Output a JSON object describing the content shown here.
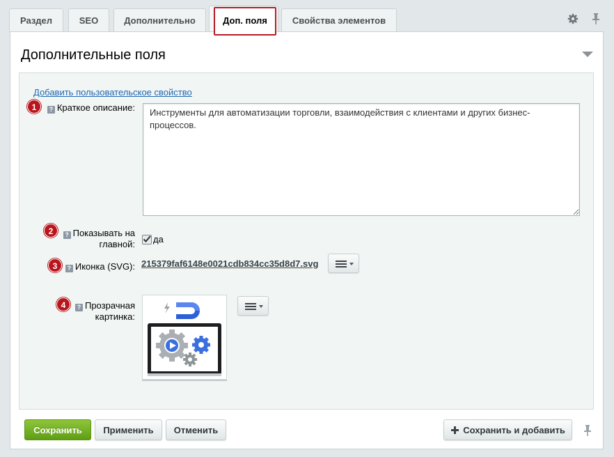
{
  "tabs": [
    {
      "label": "Раздел",
      "active": false
    },
    {
      "label": "SEO",
      "active": false
    },
    {
      "label": "Дополнительно",
      "active": false
    },
    {
      "label": "Доп. поля",
      "active": true
    },
    {
      "label": "Свойства элементов",
      "active": false
    }
  ],
  "section": {
    "title": "Дополнительные поля",
    "add_property_link": "Добавить пользовательское свойство"
  },
  "fields": [
    {
      "badge": "1",
      "label": "Краткое описание:",
      "value": "Инструменты для автоматизации торговли, взаимодействия с клиентами и других бизнес-процессов."
    },
    {
      "badge": "2",
      "label_line1": "Показывать на",
      "label_line2": "главной:",
      "checked": true,
      "checkbox_label": "да"
    },
    {
      "badge": "3",
      "label": "Иконка (SVG):",
      "file_name": "215379faf6148e0021cdb834cc35d8d7.svg"
    },
    {
      "badge": "4",
      "label_line1": "Прозрачная",
      "label_line2": "картинка:"
    }
  ],
  "help_glyph": "?",
  "buttons": {
    "save": "Сохранить",
    "apply": "Применить",
    "cancel": "Отменить",
    "save_and_add": "Сохранить и добавить"
  },
  "colors": {
    "active_tab_border": "#b51c22",
    "badge": "#b8151c",
    "link": "#2067b0",
    "save_button": "#6fae22",
    "preview_magnet_blue": "#2f5fd8",
    "preview_gear_blue": "#3b6fe0"
  },
  "icons": {
    "settings": "gear-icon",
    "pin": "pin-icon",
    "menu": "hamburger-menu-icon",
    "collapse": "triangle-down-icon",
    "add": "plus-icon"
  }
}
